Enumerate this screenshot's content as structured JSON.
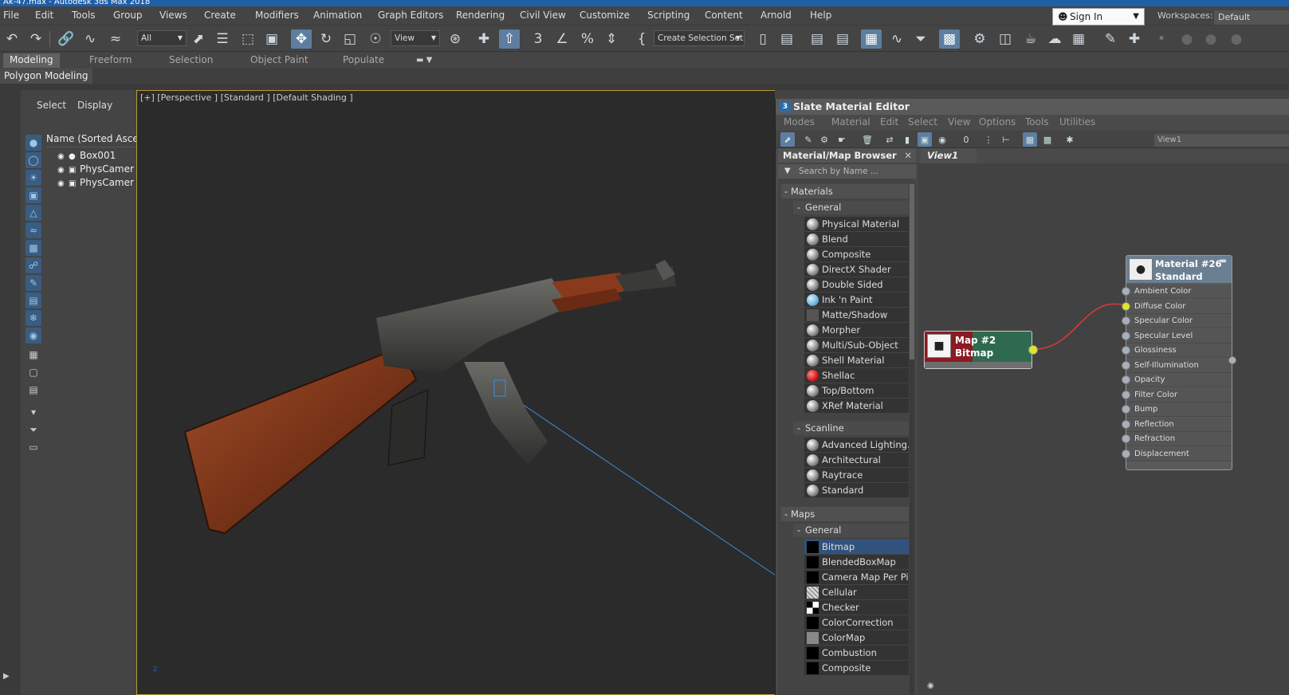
{
  "window": {
    "title": "Ak-47.max - Autodesk 3ds Max 2018"
  },
  "menubar": {
    "items": [
      "File",
      "Edit",
      "Tools",
      "Group",
      "Views",
      "Create",
      "Modifiers",
      "Animation",
      "Graph Editors",
      "Rendering",
      "Civil View",
      "Customize",
      "Scripting",
      "Content",
      "Arnold",
      "Help"
    ],
    "signin": "Sign In",
    "workspaces_label": "Workspaces:",
    "workspace_value": "Default"
  },
  "toolbar": {
    "filter_value": "All",
    "refcoord_value": "View",
    "selection_set_value": "Create Selection Set"
  },
  "ribbon": {
    "tabs": [
      "Modeling",
      "Freeform",
      "Selection",
      "Object Paint",
      "Populate"
    ],
    "active_tab": "Modeling",
    "panel_label": "Polygon Modeling"
  },
  "scene_explorer": {
    "tabs": [
      "Select",
      "Display"
    ],
    "column_header": "Name (Sorted Asce",
    "rows": [
      "Box001",
      "PhysCamer",
      "PhysCamer"
    ]
  },
  "viewport": {
    "label": "[+] [Perspective ] [Standard ] [Default Shading ]"
  },
  "slate": {
    "title": "Slate Material Editor",
    "menu": [
      "Modes",
      "Material",
      "Edit",
      "Select",
      "View",
      "Options",
      "Tools",
      "Utilities"
    ],
    "view_dropdown": "View1",
    "browser": {
      "title": "Material/Map Browser",
      "search_placeholder": "Search by Name ...",
      "materials_label": "Materials",
      "general_label": "General",
      "general_items": [
        "Physical Material",
        "Blend",
        "Composite",
        "DirectX Shader",
        "Double Sided",
        "Ink 'n Paint",
        "Matte/Shadow",
        "Morpher",
        "Multi/Sub-Object",
        "Shell Material",
        "Shellac",
        "Top/Bottom",
        "XRef Material"
      ],
      "scanline_label": "Scanline",
      "scanline_items": [
        "Advanced Lighting...",
        "Architectural",
        "Raytrace",
        "Standard"
      ],
      "maps_label": "Maps",
      "maps_general_label": "General",
      "maps_items": [
        "Bitmap",
        "BlendedBoxMap",
        "Camera Map Per Pixel",
        "Cellular",
        "Checker",
        "ColorCorrection",
        "ColorMap",
        "Combustion",
        "Composite"
      ],
      "selected_map": "Bitmap"
    },
    "view_tab": "View1",
    "map_node": {
      "line1": "Map #2",
      "line2": "Bitmap"
    },
    "material_node": {
      "line1": "Material #26",
      "line2": "Standard",
      "slots": [
        "Ambient Color",
        "Diffuse Color",
        "Specular Color",
        "Specular Level",
        "Glossiness",
        "Self-Illumination",
        "Opacity",
        "Filter Color",
        "Bump",
        "Reflection",
        "Refraction",
        "Displacement"
      ],
      "connected_slot": "Diffuse Color"
    },
    "colors": {
      "selected": "#31527d",
      "map_node": "#2f6a50",
      "map_red": "#8b1a22",
      "wire": "#d83a3a",
      "pin_lit": "#d8e82a"
    }
  }
}
